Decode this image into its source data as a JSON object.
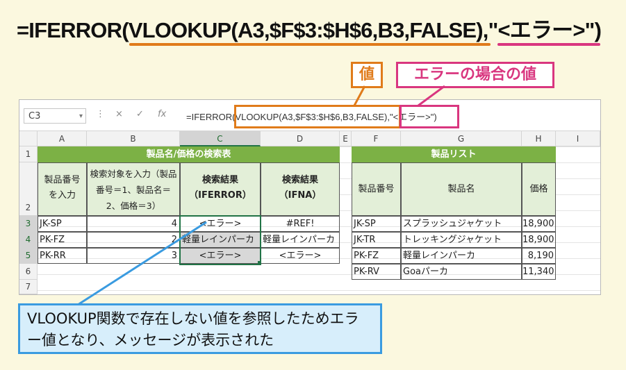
{
  "formula_title": "=IFERROR(VLOOKUP(A3,$F$3:$H$6,B3,FALSE),\"<エラー>\")",
  "callouts": {
    "value": "値",
    "error_value": "エラーの場合の値"
  },
  "colors": {
    "value_accent": "#e07b1a",
    "error_accent": "#d9367f",
    "note_accent": "#3a9be0",
    "header_green": "#7cb145"
  },
  "formula_bar": {
    "name_box": "C3",
    "name_box_arrow": "▾",
    "cancel_icon": "×",
    "enter_icon": "✓",
    "fx_icon": "fx",
    "formula_text": "=IFERROR(VLOOKUP(A3,$F$3:$H$6,B3,FALSE),\"<エラー>\")"
  },
  "sheet": {
    "columns": [
      "A",
      "B",
      "C",
      "D",
      "E",
      "F",
      "G",
      "H",
      "I"
    ],
    "rows": [
      "1",
      "2",
      "3",
      "4",
      "5",
      "6",
      "7"
    ],
    "search_table": {
      "title": "製品名/価格の検索表",
      "headers": [
        "製品番号を入力",
        "検索対象を入力（製品番号＝1、製品名＝2、価格＝3）",
        "検索結果（IFERROR）",
        "検索結果（IFNA）"
      ],
      "rows": [
        [
          "JK-SP",
          "4",
          "<エラー>",
          "#REF!"
        ],
        [
          "PK-FZ",
          "2",
          "軽量レインパーカ",
          "軽量レインパーカ"
        ],
        [
          "PK-RR",
          "3",
          "<エラー>",
          "<エラー>"
        ]
      ]
    },
    "product_list": {
      "title": "製品リスト",
      "headers": [
        "製品番号",
        "製品名",
        "価格"
      ],
      "rows": [
        [
          "JK-SP",
          "スプラッシュジャケット",
          "18,900"
        ],
        [
          "JK-TR",
          "トレッキングジャケット",
          "18,900"
        ],
        [
          "PK-FZ",
          "軽量レインパーカ",
          "8,190"
        ],
        [
          "PK-RV",
          "Goaパーカ",
          "11,340"
        ]
      ]
    }
  },
  "note": "VLOOKUP関数で存在しない値を参照したためエラー値となり、メッセージが表示された"
}
